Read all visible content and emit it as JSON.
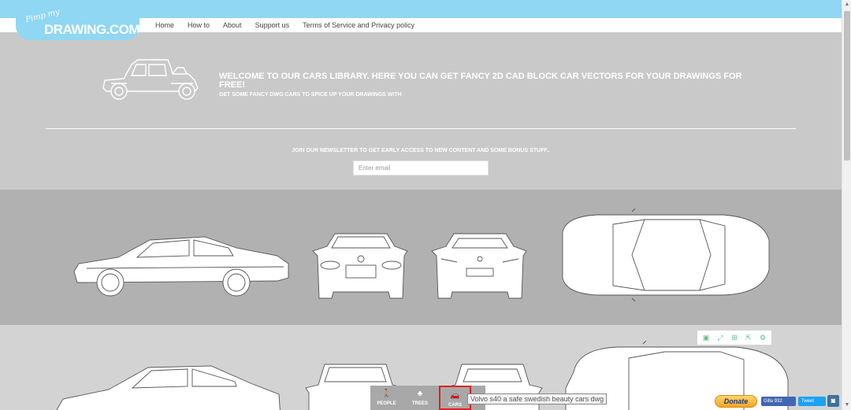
{
  "logo": {
    "script": "Pimp my",
    "main": "DRAWING.COM"
  },
  "nav": [
    "Home",
    "How to",
    "About",
    "Support us",
    "Terms of Service and Privacy policy"
  ],
  "hero": {
    "title": "WELCOME TO OUR CARS LIBRARY. HERE YOU CAN GET FANCY 2D CAD BLOCK CAR VECTORS FOR YOUR DRAWINGS FOR FREE!",
    "subtitle": "GET SOME FANCY DWG CARS TO SPICE UP YOUR DRAWINGS WITH"
  },
  "newsletter": {
    "text": "JOIN OUR NEWSLETTER TO GET EARLY ACCESS TO NEW CONTENT AND SOME BONUS STUFF..",
    "placeholder": "Enter email"
  },
  "categories": [
    {
      "label": "PEOPLE",
      "icon": "person-icon",
      "selected": false
    },
    {
      "label": "TREES",
      "icon": "tree-icon",
      "selected": false
    },
    {
      "label": "CARS",
      "icon": "car-icon",
      "selected": true
    }
  ],
  "tooltip": "Volvo s40 a safe swedish beauty cars dwg",
  "social": {
    "donate": "Donate",
    "facebook": "Gilla 932",
    "twitter": "Tweet"
  },
  "toolbar_icons": [
    "bookmark-icon",
    "fullscreen-icon",
    "save-icon",
    "share-icon",
    "settings-icon"
  ],
  "colors": {
    "accent": "#8fd7f3",
    "band_dark": "#b1b1b1",
    "band_light": "#d3d3d3",
    "selection": "#e02020"
  }
}
